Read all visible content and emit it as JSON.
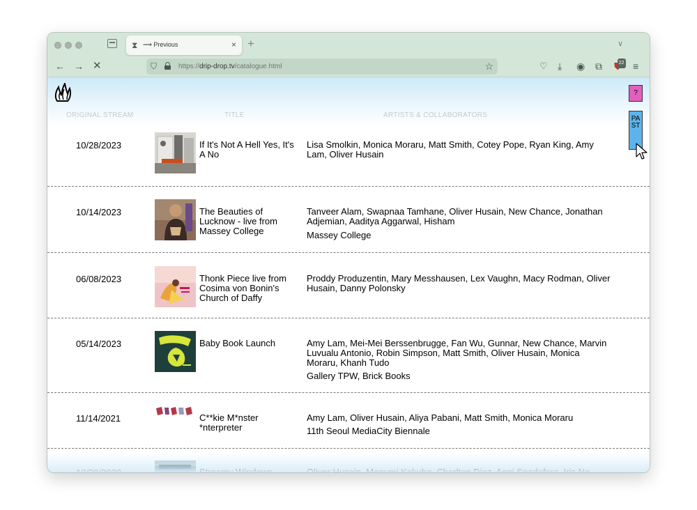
{
  "browser": {
    "tab_title": "⟶ Previous",
    "url_scheme": "https://",
    "url_host": "drip-drop.tv",
    "url_path": "/catalogue.html",
    "extension_badge": "22"
  },
  "columns": {
    "stream": "ORIGINAL STREAM",
    "title": "TITLE",
    "artists": "ARTISTS & COLLABORATORS"
  },
  "side_buttons": {
    "help": "?",
    "past": "PAST"
  },
  "rows": [
    {
      "date": "10/28/2023",
      "title": "If It's Not A Hell Yes, It's A No",
      "artists": "Lisa Smolkin, Monica Moraru, Matt Smith, Cotey Pope, Ryan King, Amy Lam, Oliver Husain",
      "venue": ""
    },
    {
      "date": "10/14/2023",
      "title": "The Beauties of Lucknow - live from Massey College",
      "artists": "Tanveer Alam, Swapnaa Tamhane, Oliver Husain, New Chance, Jonathan Adjemian, Aaditya Aggarwal, Hisham",
      "venue": "Massey College"
    },
    {
      "date": "06/08/2023",
      "title": "Thonk Piece live from Cosima von Bonin's Church of Daffy",
      "artists": "Proddy Produzentin, Mary Messhausen, Lex Vaughn, Macy Rodman, Oliver Husain, Danny Polonsky",
      "venue": ""
    },
    {
      "date": "05/14/2023",
      "title": "Baby Book Launch",
      "artists": "Amy Lam, Mei-Mei Berssenbrugge, Fan Wu, Gunnar, New Chance, Marvin Luvualu Antonio, Robin Simpson, Matt Smith, Oliver Husain, Monica Moraru, Khanh Tudo",
      "venue": "Gallery TPW, Brick Books"
    },
    {
      "date": "11/14/2021",
      "title": "C**kie M*nster *nterpreter",
      "artists": "Amy Lam, Oliver Husain, Aliya Pabani, Matt Smith, Monica Moraru",
      "venue": "11th Seoul MediaCity Biennale"
    },
    {
      "date": "10/29/2020",
      "title": "Streamy Windows",
      "artists": "Oliver Husain, Megumi Kakuba, Charlton Diaz, Anni Spadafora, Iris Ng",
      "venue": ""
    }
  ]
}
